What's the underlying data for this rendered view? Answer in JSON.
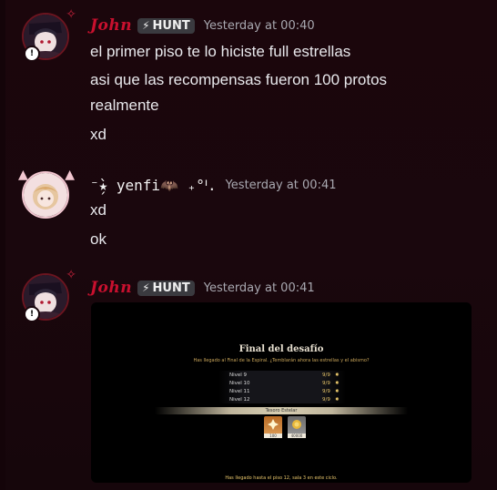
{
  "messages": [
    {
      "author": "John",
      "tag": "HUNT",
      "timestamp": "Yesterday at 00:40",
      "lines": [
        "el primer piso te lo hiciste full estrellas",
        "asi que las recompensas fueron 100 protos",
        "realmente",
        "xd"
      ]
    },
    {
      "author": "⁻̗̀★ yenfi🦇 ₊°ᑊ.",
      "timestamp": "Yesterday at 00:41",
      "lines": [
        "xd",
        "ok"
      ]
    },
    {
      "author": "John",
      "tag": "HUNT",
      "timestamp": "Yesterday at 00:41",
      "attachment": {
        "title": "Final del desafío",
        "subtitle": "Has llegado al Final de la Espiral. ¿Temblarán ahora las estrellas y el abismo?",
        "rows": [
          {
            "level": "Nivel 9",
            "score": "9/9"
          },
          {
            "level": "Nivel 10",
            "score": "9/9"
          },
          {
            "level": "Nivel 11",
            "score": "9/9"
          },
          {
            "level": "Nivel 12",
            "score": "9/9"
          }
        ],
        "banner": "Tesoro Estelar",
        "rewards": [
          {
            "count": "100"
          },
          {
            "count": "40000"
          }
        ],
        "footer": "Has llegado hasta el piso 12, sala 3 en este ciclo."
      }
    }
  ],
  "colors": {
    "background": "#1a070d",
    "john_name": "#c8102e",
    "text": "#e8e8ec",
    "timestamp": "#a8a8b0",
    "tag_bg": "#3a3a3f"
  },
  "icons": {
    "tag_icon": "lightning-bolt-icon",
    "star": "star-icon"
  }
}
